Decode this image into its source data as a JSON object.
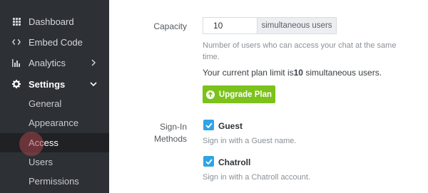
{
  "sidebar": {
    "items": [
      {
        "label": "Dashboard",
        "icon": "grid-icon"
      },
      {
        "label": "Embed Code",
        "icon": "code-icon"
      },
      {
        "label": "Analytics",
        "icon": "bar-chart-icon"
      },
      {
        "label": "Settings",
        "icon": "gear-icon"
      }
    ],
    "sub_items": [
      {
        "label": "General"
      },
      {
        "label": "Appearance"
      },
      {
        "label": "Access",
        "active": true
      },
      {
        "label": "Users"
      },
      {
        "label": "Permissions"
      }
    ]
  },
  "capacity": {
    "label": "Capacity",
    "value": "10",
    "addon": "simultaneous users",
    "help_line1": "Number of users who can access your chat at the same",
    "help_line2": "time.",
    "plan_limit_prefix": "Your current plan limit is",
    "plan_limit_value": "10",
    "plan_limit_suffix": " simultaneous users.",
    "upgrade_label": "Upgrade Plan"
  },
  "signin": {
    "label_line1": "Sign-In",
    "label_line2": "Methods",
    "methods": [
      {
        "label": "Guest",
        "checked": true,
        "help": "Sign in with a Guest name."
      },
      {
        "label": "Chatroll",
        "checked": true,
        "help": "Sign in with a Chatroll account."
      }
    ]
  },
  "colors": {
    "sidebar_bg": "#2d3034",
    "active_bg": "#1f2124",
    "accent_green": "#7cc21b",
    "checkbox_blue": "#2fa3e6"
  }
}
